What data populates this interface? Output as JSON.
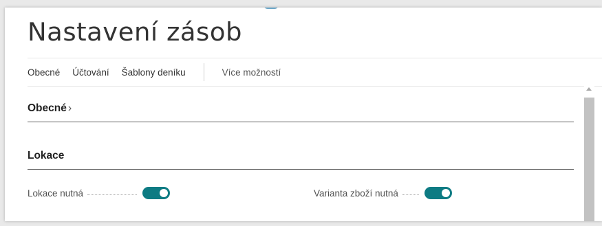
{
  "page": {
    "title": "Nastavení zásob"
  },
  "actions": {
    "items": [
      "Obecné",
      "Účtování",
      "Šablony deníku"
    ],
    "more_label": "Více možností"
  },
  "sections": {
    "general": {
      "label": "Obecné",
      "chevron": "›"
    },
    "location": {
      "label": "Lokace"
    }
  },
  "fields": {
    "location_mandatory": {
      "label": "Lokace nutná",
      "value": true
    },
    "variant_mandatory": {
      "label": "Varianta zboží nutná",
      "value": true
    }
  },
  "colors": {
    "toggle_on": "#0d7b83",
    "accent": "#6aa6c8"
  }
}
